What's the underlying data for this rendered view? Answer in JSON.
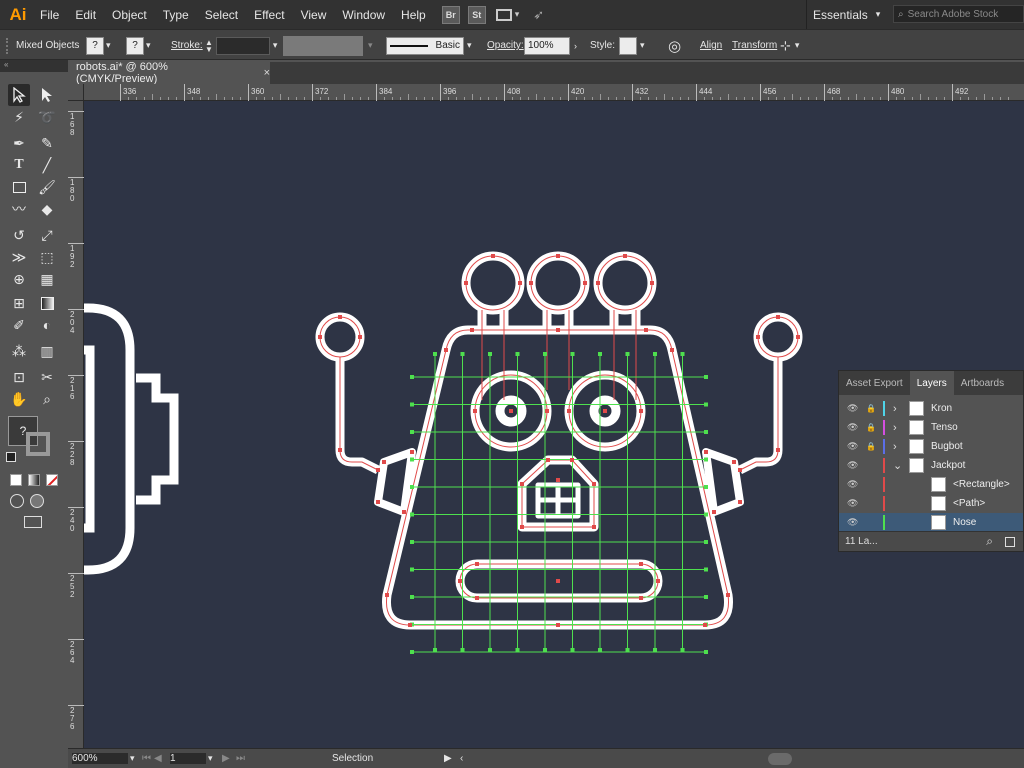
{
  "app": {
    "logo": "Ai"
  },
  "menu": [
    "File",
    "Edit",
    "Object",
    "Type",
    "Select",
    "Effect",
    "View",
    "Window",
    "Help"
  ],
  "menubar_icons": {
    "bridge": "Br",
    "stock": "St"
  },
  "workspace": {
    "label": "Essentials"
  },
  "search": {
    "placeholder": "Search Adobe Stock"
  },
  "control": {
    "selection_type": "Mixed Objects",
    "stroke_label": "Stroke:",
    "brush_label": "Basic",
    "opacity_label": "Opacity:",
    "opacity_value": "100%",
    "style_label": "Style:",
    "align_label": "Align",
    "transform_label": "Transform",
    "unknown_mark": "?"
  },
  "document": {
    "tab_title": "robots.ai* @ 600% (CMYK/Preview)",
    "close": "×"
  },
  "ruler": {
    "h_ticks": [
      "336",
      "348",
      "360",
      "372",
      "384",
      "396",
      "408",
      "420",
      "432",
      "444",
      "456",
      "468",
      "480",
      "492"
    ],
    "v_ticks": [
      "168",
      "180",
      "192",
      "204",
      "216",
      "228",
      "240",
      "252",
      "264",
      "276"
    ]
  },
  "status": {
    "zoom": "600%",
    "artboard": "1",
    "tool": "Selection"
  },
  "layers_panel": {
    "tabs": [
      "Asset Export",
      "Layers",
      "Artboards"
    ],
    "active_tab": "Layers",
    "rows": [
      {
        "name": "Kron",
        "color": "#4fd4e8"
      },
      {
        "name": "Tenso",
        "color": "#d44fe0"
      },
      {
        "name": "Bugbot",
        "color": "#5b6ee8"
      },
      {
        "name": "Jackpot",
        "color": "#e04a4a"
      },
      {
        "name": "<Rectangle>",
        "color": "#e04a4a"
      },
      {
        "name": "<Path>",
        "color": "#e04a4a"
      },
      {
        "name": "Nose",
        "color": "#4ee04e"
      }
    ],
    "footer": "11 La..."
  },
  "colors": {
    "canvas": "#2e3445",
    "artwork": "#ffffff",
    "anchor": "#e04a4a",
    "grid": "#4ee04e"
  }
}
